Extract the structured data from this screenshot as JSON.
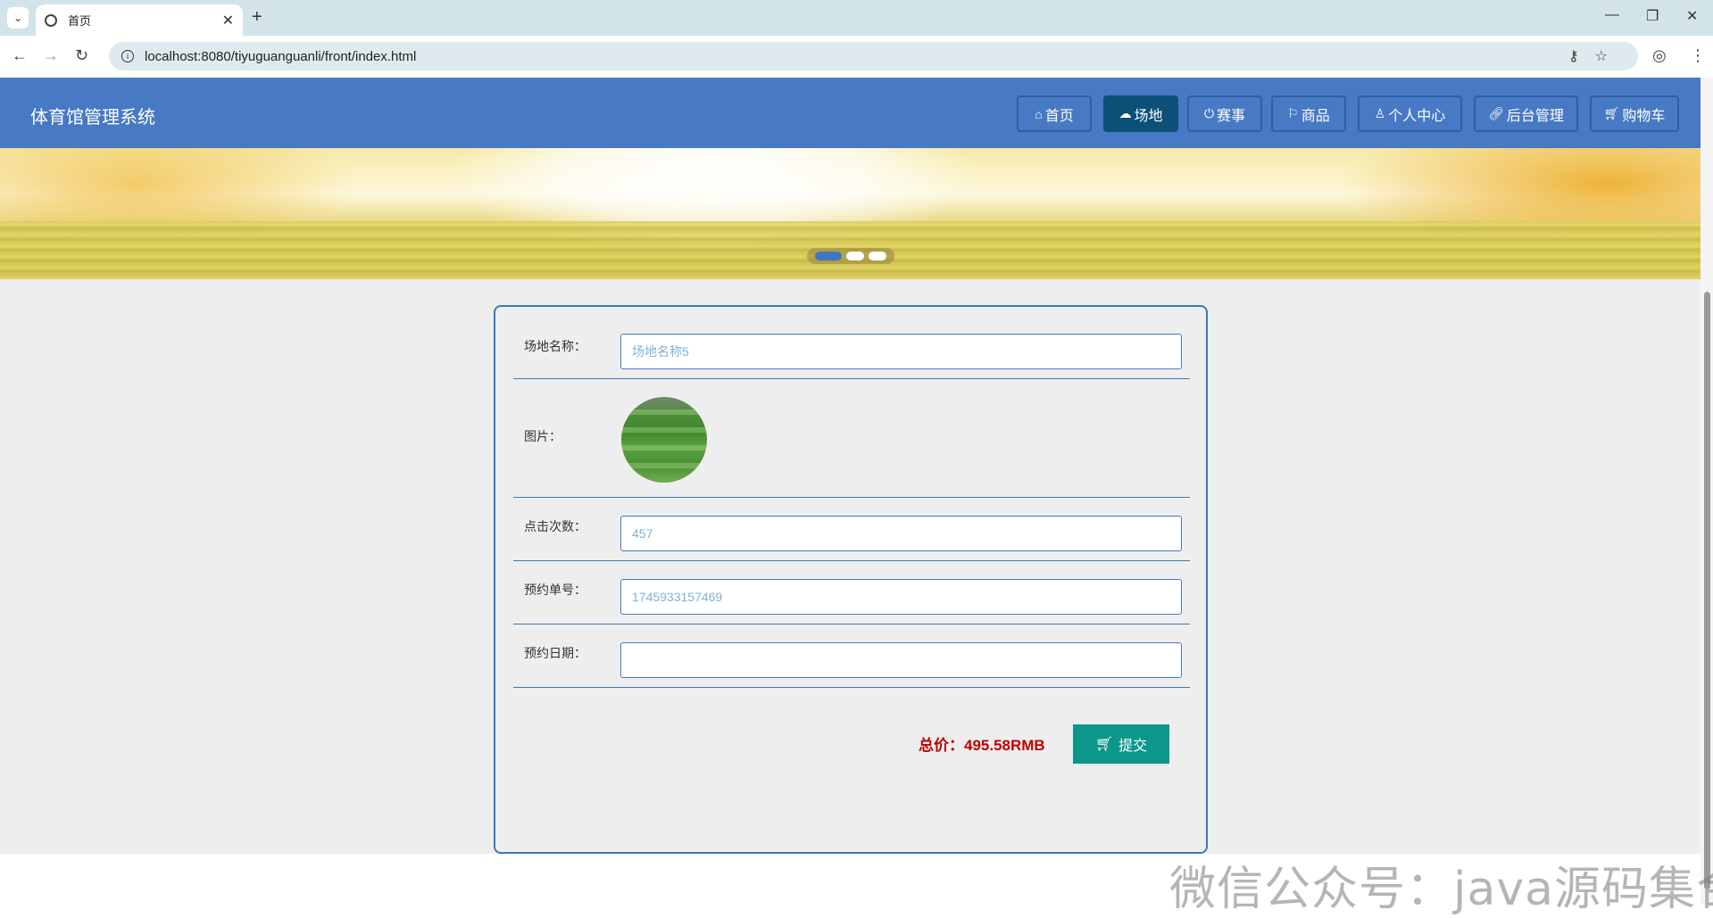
{
  "browser": {
    "tab_title": "首页",
    "url": "localhost:8080/tiyuguanguanli/front/index.html"
  },
  "header": {
    "site_title": "体育馆管理系统",
    "nav": [
      {
        "label": "首页",
        "icon": "home-icon",
        "active": false
      },
      {
        "label": "场地",
        "icon": "cloud-icon",
        "active": true
      },
      {
        "label": "赛事",
        "icon": "power-icon",
        "active": false
      },
      {
        "label": "商品",
        "icon": "flag-icon",
        "active": false
      },
      {
        "label": "个人中心",
        "icon": "user-icon",
        "active": false
      },
      {
        "label": "后台管理",
        "icon": "link-icon",
        "active": false
      },
      {
        "label": "购物车",
        "icon": "cart-icon",
        "active": false
      }
    ]
  },
  "banner": {
    "slides": 3,
    "active_slide": 1
  },
  "form": {
    "venue_name_label": "场地名称：",
    "venue_name_value": "场地名称5",
    "image_label": "图片：",
    "clicks_label": "点击次数：",
    "clicks_value": "457",
    "booking_no_label": "预约单号：",
    "booking_no_value": "1745933157469",
    "booking_date_label": "预约日期：",
    "booking_date_value": ""
  },
  "order": {
    "total_text": "总价：495.58RMB",
    "submit_label": "提交"
  },
  "watermark": "微信公众号：java源码集合",
  "colors": {
    "header_bg": "#4879c4",
    "nav_active": "#0c5077",
    "price": "#c00000",
    "submit_bg": "#0d968a"
  }
}
